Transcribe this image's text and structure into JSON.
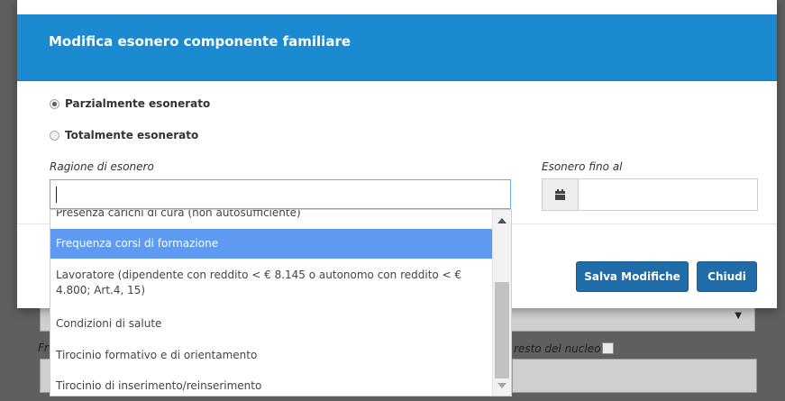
{
  "modal": {
    "title": "Modifica esonero componente familiare",
    "radios": [
      {
        "label": "Parzialmente esonerato",
        "checked": true
      },
      {
        "label": "Totalmente esonerato",
        "checked": false
      }
    ],
    "reason_label": "Ragione di esonero",
    "reason_value": "",
    "date_label": "Esonero fino al",
    "date_value": "",
    "save_label": "Salva Modifiche",
    "close_label": "Chiudi"
  },
  "dropdown": {
    "options": [
      "Presenza carichi di cura (non autosufficiente)",
      "Frequenza corsi di formazione",
      "Lavoratore (dipendente con reddito < € 8.145 o autonomo con reddito < € 4.800; Art.4, 15)",
      "Condizioni di salute",
      "Tirocinio formativo e di orientamento",
      "Tirocinio di inserimento/reinserimento"
    ],
    "highlighted_index": 1
  },
  "background": {
    "label_left": "Fr",
    "label_right": "resto del nucleo"
  },
  "colors": {
    "header": "#1c8ad1",
    "button": "#1f6ca8",
    "highlight": "#5e9af2"
  }
}
